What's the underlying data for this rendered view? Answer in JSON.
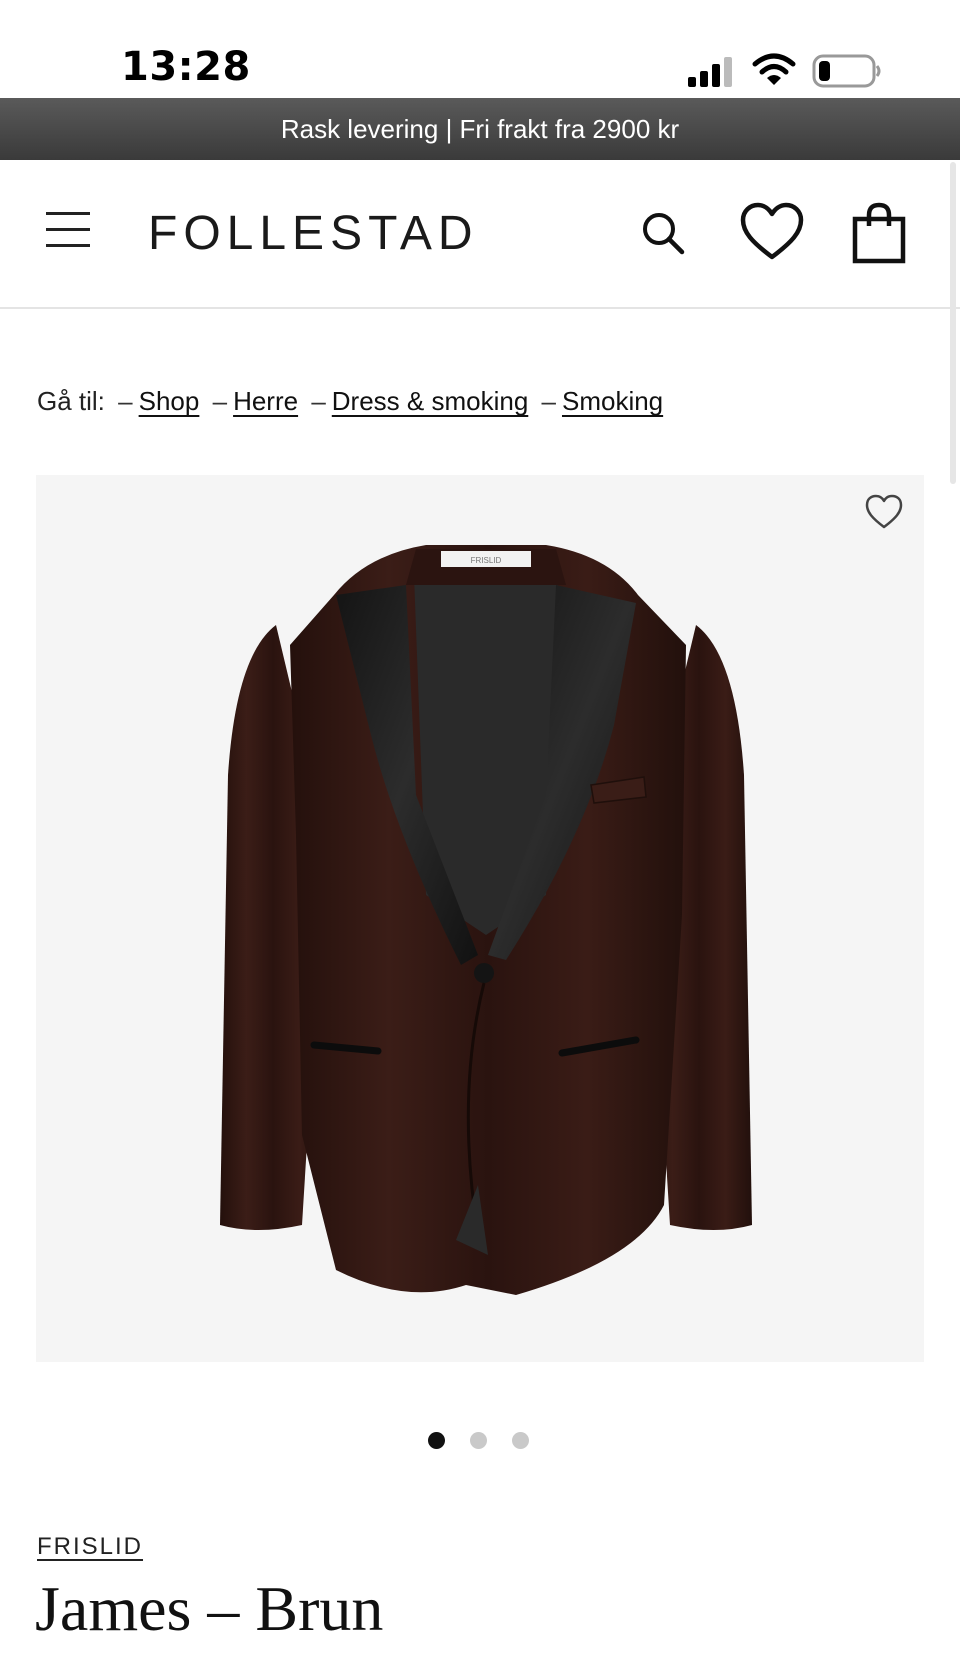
{
  "status_bar": {
    "time": "13:28"
  },
  "promo_banner": {
    "text": "Rask levering | Fri frakt fra 2900 kr"
  },
  "header": {
    "logo": "FOLLESTAD",
    "icons": [
      "menu-icon",
      "search-icon",
      "heart-icon",
      "shopping-bag-icon"
    ]
  },
  "breadcrumb": {
    "prefix": "Gå til:",
    "separator": "–",
    "items": [
      "Shop",
      "Herre",
      "Dress & smoking",
      "Smoking"
    ]
  },
  "gallery": {
    "label_on_garment": "FRISLID",
    "slide_count": 3,
    "active_slide": 1
  },
  "product": {
    "brand": "FRISLID",
    "title": "James – Brun"
  },
  "colors": {
    "promo_bg": "#4a4a4a",
    "gallery_bg": "#f5f5f5",
    "jacket": "#2e1612",
    "lapel": "#1c1c1c",
    "active_dot": "#111111",
    "inactive_dot": "#c9c9c9"
  }
}
